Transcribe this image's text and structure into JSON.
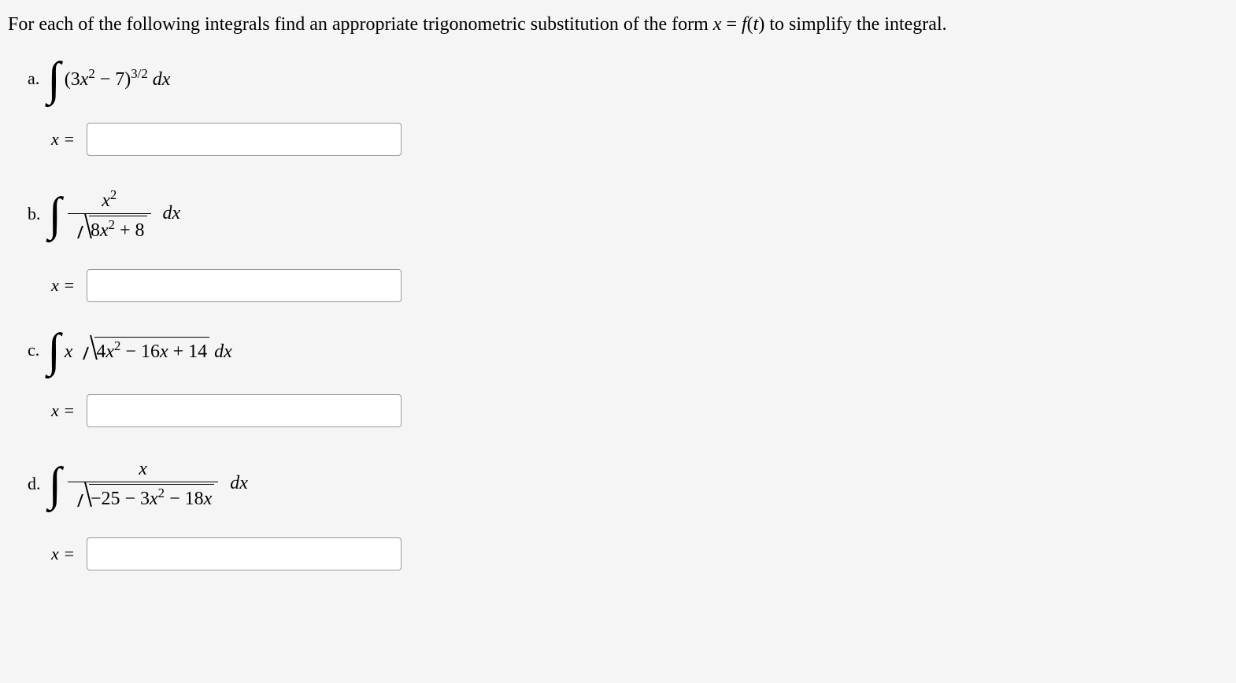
{
  "instruction": "For each of the following integrals find an appropriate trigonometric substitution of the form x = f(t) to simplify the integral.",
  "problems": {
    "a": {
      "label": "a.",
      "integrand": "(3x² − 7)",
      "exponent": "3/2",
      "dx": " dx",
      "x_equals": "x ="
    },
    "b": {
      "label": "b.",
      "numerator": "x²",
      "denominator_radicand": "8x² + 8",
      "dx": " dx",
      "x_equals": "x ="
    },
    "c": {
      "label": "c.",
      "before_radical": "x",
      "radicand": "4x² − 16x + 14",
      "dx": " dx",
      "x_equals": "x ="
    },
    "d": {
      "label": "d.",
      "numerator": "x",
      "denominator_radicand": "−25 − 3x² − 18x",
      "dx": " dx",
      "x_equals": "x ="
    }
  }
}
